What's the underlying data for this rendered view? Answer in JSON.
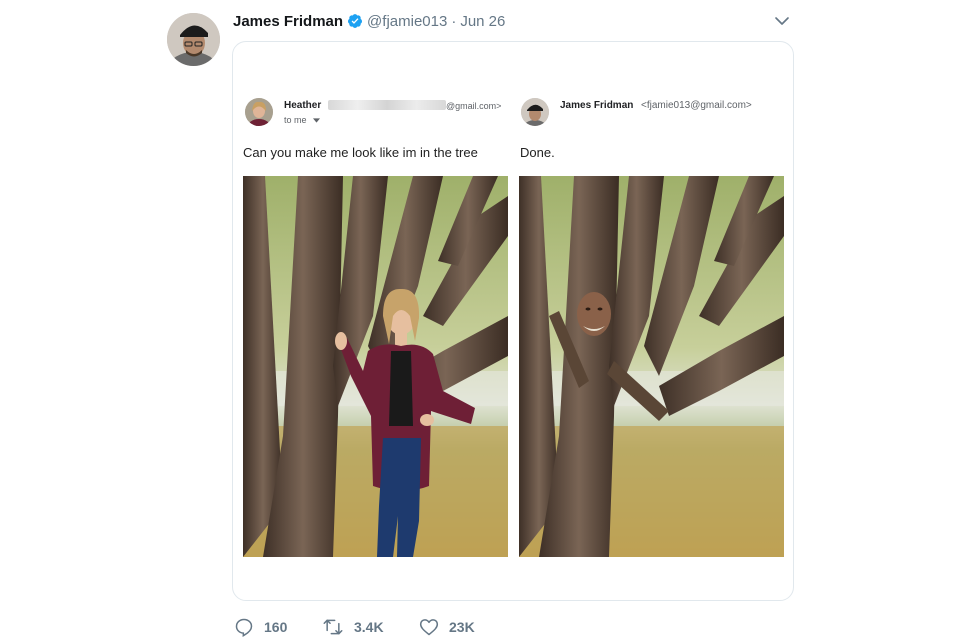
{
  "tweet": {
    "display_name": "James Fridman",
    "handle": "@fjamie013",
    "separator": "·",
    "date": "Jun 26"
  },
  "left_email": {
    "sender_name": "Heather",
    "sender_domain": "@gmail.com>",
    "recipient": "to me",
    "body": "Can you make me look like im in the tree"
  },
  "right_email": {
    "sender_name": "James Fridman",
    "sender_address": "<fjamie013@gmail.com>",
    "body": "Done."
  },
  "actions": {
    "replies": "160",
    "retweets": "3.4K",
    "likes": "23K"
  },
  "colors": {
    "verified": "#1da1f2",
    "muted": "#657786",
    "border": "#e1e8ed"
  },
  "icons": [
    "verified-badge-icon",
    "chevron-down-icon",
    "reply-icon",
    "retweet-icon",
    "like-icon"
  ]
}
